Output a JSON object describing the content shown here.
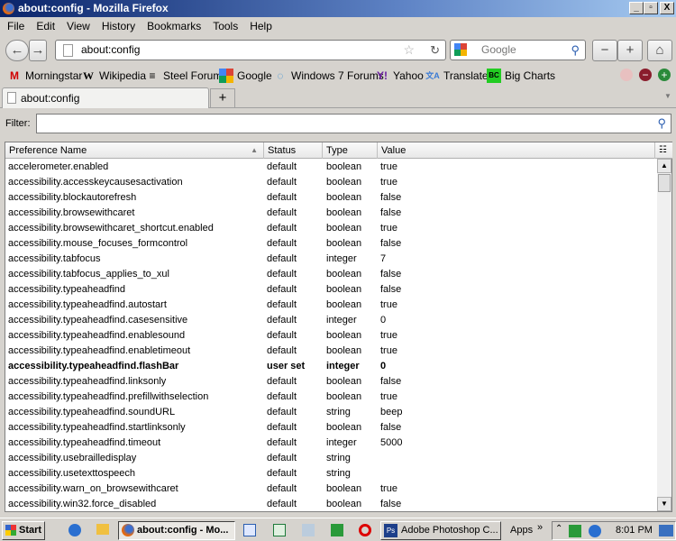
{
  "window": {
    "title": "about:config - Mozilla Firefox",
    "min": "_",
    "max": "▫",
    "close": "X"
  },
  "menu": [
    "File",
    "Edit",
    "View",
    "History",
    "Bookmarks",
    "Tools",
    "Help"
  ],
  "nav": {
    "url": "about:config",
    "search_placeholder": "Google",
    "zoom_out": "−",
    "zoom_in": "+"
  },
  "bookmarks": [
    {
      "label": "Morningstar",
      "icon": "M",
      "color": "#d10000"
    },
    {
      "label": "Wikipedia",
      "icon": "W",
      "color": "#000000"
    },
    {
      "label": "Steel Forum",
      "icon": "≡",
      "color": "#000000"
    },
    {
      "label": "Google",
      "icon": "g",
      "color": "#3366cc"
    },
    {
      "label": "Windows 7 Forums",
      "icon": "◌",
      "color": "#2a8ad4"
    },
    {
      "label": "Yahoo",
      "icon": "Y!",
      "color": "#6b1fa0"
    },
    {
      "label": "Translate",
      "icon": "文A",
      "color": "#3a7bd5"
    },
    {
      "label": "Big Charts",
      "icon": "BC",
      "color": "#22aa22"
    }
  ],
  "tab": {
    "label": "about:config",
    "new_tab": "+"
  },
  "filter": {
    "label": "Filter:",
    "value": ""
  },
  "columns": [
    "Preference Name",
    "Status",
    "Type",
    "Value"
  ],
  "rows": [
    [
      "accelerometer.enabled",
      "default",
      "boolean",
      "true"
    ],
    [
      "accessibility.accesskeycausesactivation",
      "default",
      "boolean",
      "true"
    ],
    [
      "accessibility.blockautorefresh",
      "default",
      "boolean",
      "false"
    ],
    [
      "accessibility.browsewithcaret",
      "default",
      "boolean",
      "false"
    ],
    [
      "accessibility.browsewithcaret_shortcut.enabled",
      "default",
      "boolean",
      "true"
    ],
    [
      "accessibility.mouse_focuses_formcontrol",
      "default",
      "boolean",
      "false"
    ],
    [
      "accessibility.tabfocus",
      "default",
      "integer",
      "7"
    ],
    [
      "accessibility.tabfocus_applies_to_xul",
      "default",
      "boolean",
      "false"
    ],
    [
      "accessibility.typeaheadfind",
      "default",
      "boolean",
      "false"
    ],
    [
      "accessibility.typeaheadfind.autostart",
      "default",
      "boolean",
      "true"
    ],
    [
      "accessibility.typeaheadfind.casesensitive",
      "default",
      "integer",
      "0"
    ],
    [
      "accessibility.typeaheadfind.enablesound",
      "default",
      "boolean",
      "true"
    ],
    [
      "accessibility.typeaheadfind.enabletimeout",
      "default",
      "boolean",
      "true"
    ],
    [
      "accessibility.typeaheadfind.flashBar",
      "user set",
      "integer",
      "0"
    ],
    [
      "accessibility.typeaheadfind.linksonly",
      "default",
      "boolean",
      "false"
    ],
    [
      "accessibility.typeaheadfind.prefillwithselection",
      "default",
      "boolean",
      "true"
    ],
    [
      "accessibility.typeaheadfind.soundURL",
      "default",
      "string",
      "beep"
    ],
    [
      "accessibility.typeaheadfind.startlinksonly",
      "default",
      "boolean",
      "false"
    ],
    [
      "accessibility.typeaheadfind.timeout",
      "default",
      "integer",
      "5000"
    ],
    [
      "accessibility.usebrailledisplay",
      "default",
      "string",
      ""
    ],
    [
      "accessibility.usetexttospeech",
      "default",
      "string",
      ""
    ],
    [
      "accessibility.warn_on_browsewithcaret",
      "default",
      "boolean",
      "true"
    ],
    [
      "accessibility.win32.force_disabled",
      "default",
      "boolean",
      "false"
    ]
  ],
  "taskbar": {
    "start": "Start",
    "firefox": "about:config - Mo...",
    "photoshop": "Adobe Photoshop C...",
    "apps": "Apps",
    "chevron": "»",
    "time": "8:01 PM"
  }
}
